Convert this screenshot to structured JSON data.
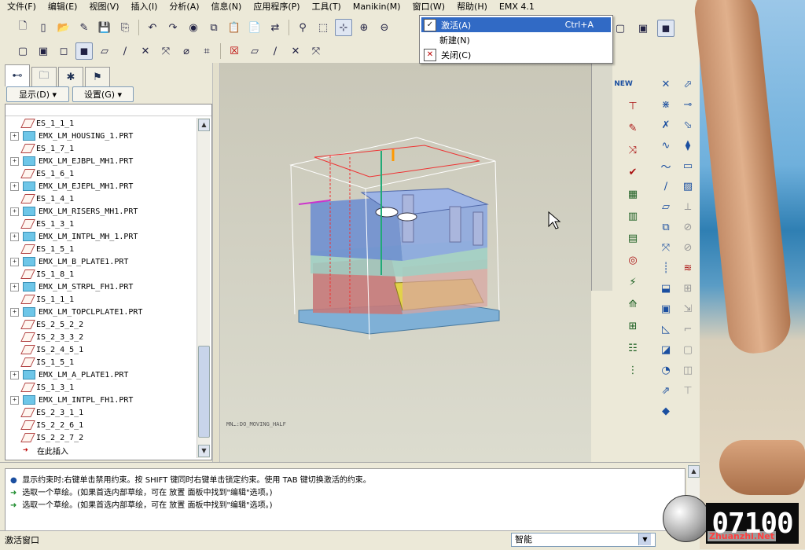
{
  "menubar": {
    "items": [
      "文件(F)",
      "编辑(E)",
      "视图(V)",
      "插入(I)",
      "分析(A)",
      "信息(N)",
      "应用程序(P)",
      "工具(T)",
      "Manikin(M)",
      "窗口(W)",
      "帮助(H)",
      "EMX 4.1"
    ]
  },
  "window_menu": {
    "items": [
      {
        "label": "激活(A)",
        "shortcut": "Ctrl+A",
        "icon": "activate-window-icon",
        "highlighted": true
      },
      {
        "label": "新建(N)",
        "shortcut": "",
        "icon": "",
        "highlighted": false
      },
      {
        "label": "关闭(C)",
        "shortcut": "",
        "icon": "close-window-icon",
        "highlighted": false
      }
    ]
  },
  "nav": {
    "display_btn": "显示(D) ▾",
    "settings_btn": "设置(G) ▾"
  },
  "tree": {
    "rows": [
      {
        "label": "ES_1_1_1",
        "type": "plane",
        "expandable": false
      },
      {
        "label": "EMX_LM_HOUSING_1.PRT",
        "type": "part",
        "expandable": true
      },
      {
        "label": "ES_1_7_1",
        "type": "plane",
        "expandable": false
      },
      {
        "label": "EMX_LM_EJBPL_MH1.PRT",
        "type": "part",
        "expandable": true
      },
      {
        "label": "ES_1_6_1",
        "type": "plane",
        "expandable": false
      },
      {
        "label": "EMX_LM_EJEPL_MH1.PRT",
        "type": "part",
        "expandable": true
      },
      {
        "label": "ES_1_4_1",
        "type": "plane",
        "expandable": false
      },
      {
        "label": "EMX_LM_RISERS_MH1.PRT",
        "type": "part",
        "expandable": true
      },
      {
        "label": "ES_1_3_1",
        "type": "plane",
        "expandable": false
      },
      {
        "label": "EMX_LM_INTPL_MH_1.PRT",
        "type": "part",
        "expandable": true
      },
      {
        "label": "ES_1_5_1",
        "type": "plane",
        "expandable": false
      },
      {
        "label": "EMX_LM_B_PLATE1.PRT",
        "type": "part",
        "expandable": true
      },
      {
        "label": "IS_1_8_1",
        "type": "plane",
        "expandable": false
      },
      {
        "label": "EMX_LM_STRPL_FH1.PRT",
        "type": "part",
        "expandable": true
      },
      {
        "label": "IS_1_1_1",
        "type": "plane",
        "expandable": false
      },
      {
        "label": "EMX_LM_TOPCLPLATE1.PRT",
        "type": "part",
        "expandable": true
      },
      {
        "label": "ES_2_5_2_2",
        "type": "plane",
        "expandable": false
      },
      {
        "label": "IS_2_3_3_2",
        "type": "plane",
        "expandable": false
      },
      {
        "label": "IS_2_4_5_1",
        "type": "plane",
        "expandable": false
      },
      {
        "label": "IS_1_5_1",
        "type": "plane",
        "expandable": false
      },
      {
        "label": "EMX_LM_A_PLATE1.PRT",
        "type": "part",
        "expandable": true
      },
      {
        "label": "IS_1_3_1",
        "type": "plane",
        "expandable": false
      },
      {
        "label": "EMX_LM_INTPL_FH1.PRT",
        "type": "part",
        "expandable": true
      },
      {
        "label": "ES_2_3_1_1",
        "type": "plane",
        "expandable": false
      },
      {
        "label": "IS_2_2_6_1",
        "type": "plane",
        "expandable": false
      },
      {
        "label": "IS_2_2_7_2",
        "type": "plane",
        "expandable": false
      },
      {
        "label": "在此插入",
        "type": "insert",
        "expandable": false
      }
    ]
  },
  "graphics": {
    "watermark": "MN…:DO_MOVING_HALF"
  },
  "messages": [
    {
      "marker": "●",
      "text": "显示约束时:右键单击禁用约束。按 SHIFT 键同时右键单击锁定约束。使用 TAB 键切换激活的约束。"
    },
    {
      "marker": "➜",
      "text": "选取一个草绘。(如果首选内部草绘，可在 放置 面板中找到\"编辑\"选项。)"
    },
    {
      "marker": "➜",
      "text": "选取一个草绘。(如果首选内部草绘，可在 放置 面板中找到\"编辑\"选项。)"
    }
  ],
  "status": {
    "text": "激活窗口",
    "filter_value": "智能"
  },
  "watermark_logo": {
    "number": "07100",
    "site": "Zhuanzhi.Net"
  }
}
